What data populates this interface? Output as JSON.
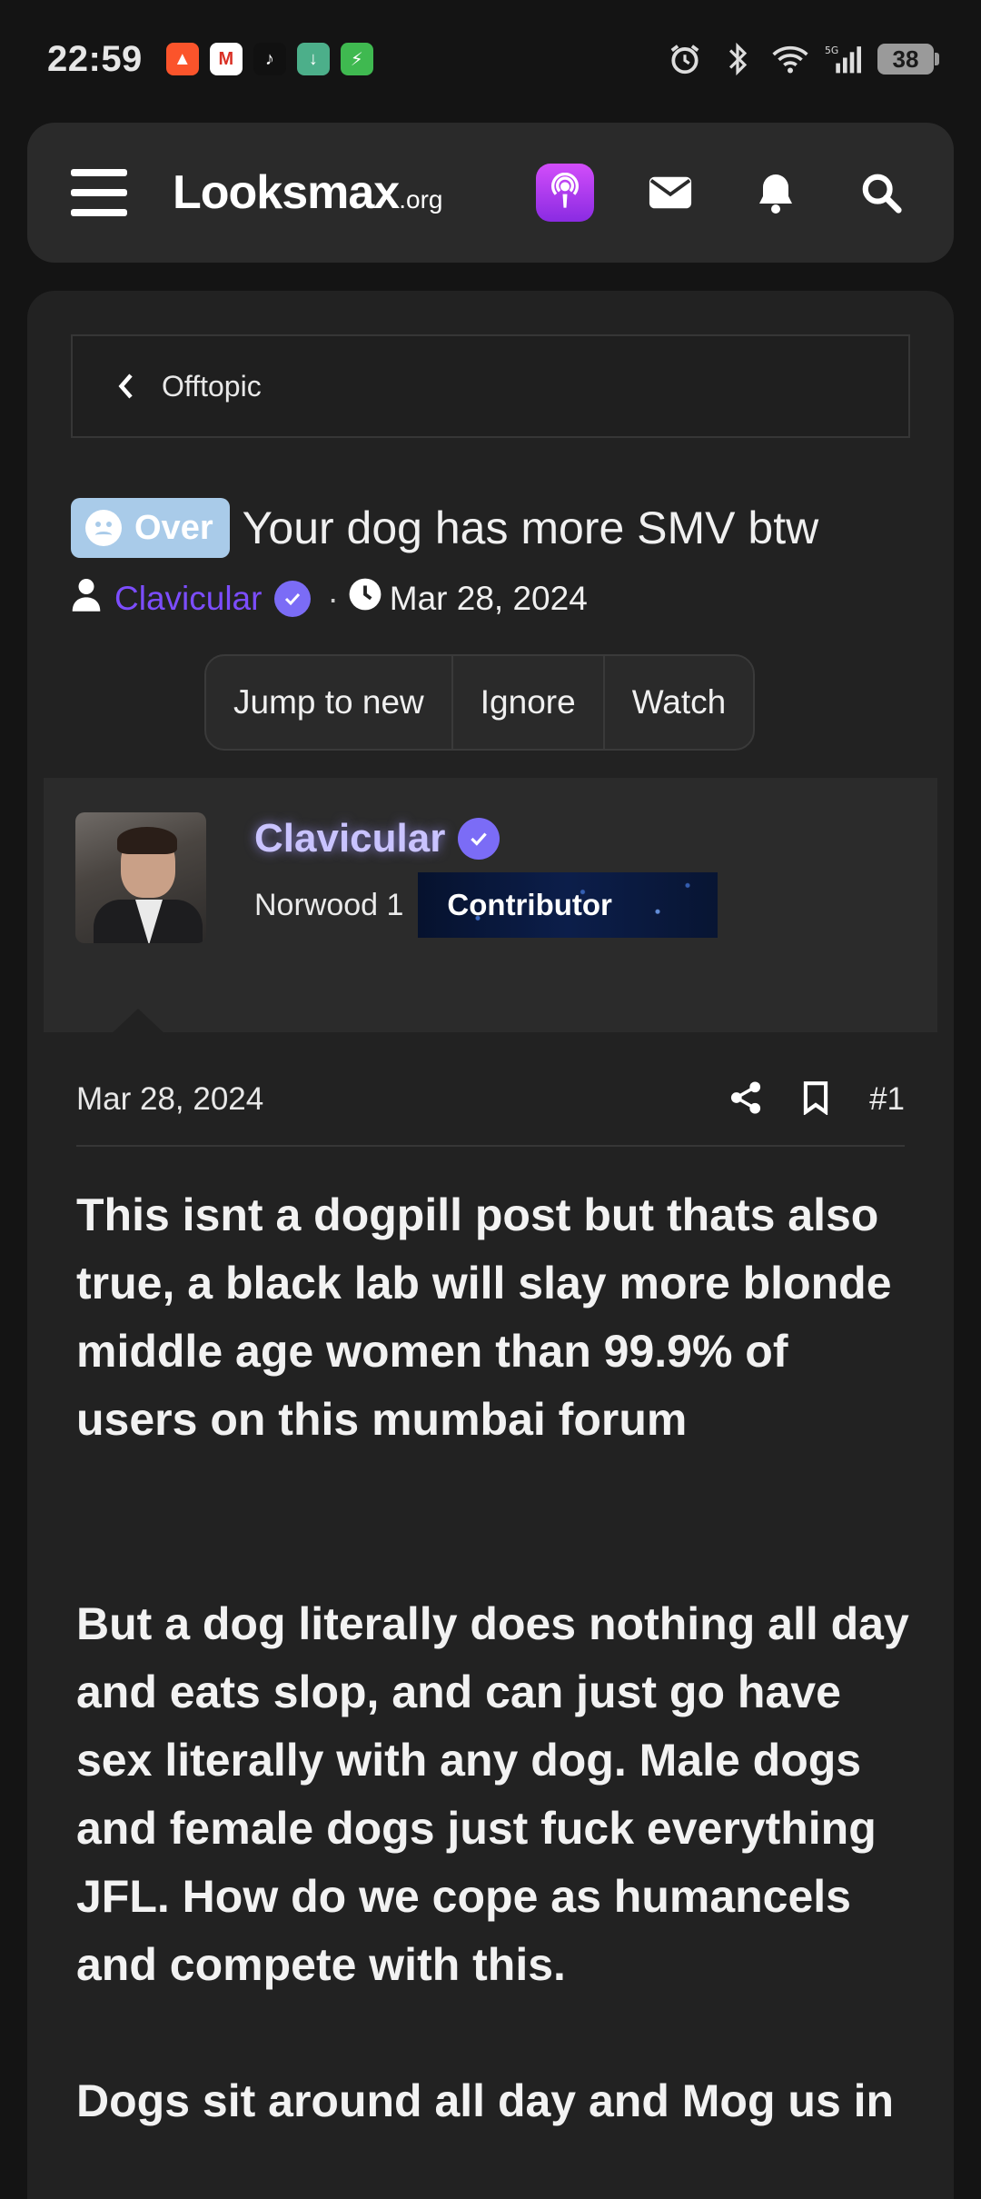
{
  "status_bar": {
    "time": "22:59",
    "battery": "38",
    "network": "5G",
    "apps": [
      {
        "name": "brave",
        "color": "#fb542b",
        "glyph": "▲"
      },
      {
        "name": "gmail",
        "color": "#ffffff",
        "glyph": "M"
      },
      {
        "name": "tiktok",
        "color": "#111111",
        "glyph": "♪"
      },
      {
        "name": "downloader",
        "color": "#4caf8a",
        "glyph": "↓"
      },
      {
        "name": "shield",
        "color": "#3fb950",
        "glyph": "⚡"
      }
    ]
  },
  "header": {
    "logo": "Looksmax",
    "logo_suffix": ".org",
    "icons": [
      "hamburger-menu-icon",
      "podcast-icon",
      "envelope-icon",
      "bell-icon",
      "search-icon"
    ]
  },
  "breadcrumb": {
    "label": "Offtopic"
  },
  "thread": {
    "prefix": "Over",
    "title": "Your dog has more SMV btw",
    "author": "Clavicular",
    "date": "Mar 28, 2024",
    "separator": "·"
  },
  "thread_buttons": {
    "jump": "Jump to new",
    "ignore": "Ignore",
    "watch": "Watch"
  },
  "post": {
    "author_name": "Clavicular",
    "author_title": "Norwood 1",
    "banner": "Contributor",
    "date": "Mar 28, 2024",
    "number": "#1",
    "paragraphs": [
      "This isnt a dogpill post but thats also true, a black lab will slay more blonde middle age women than 99.9% of users on this mumbai forum",
      "But a dog literally does nothing all day and eats slop, and can just go have sex literally with any dog. Male dogs and female dogs just fuck everything JFL. How do we cope as humancels and compete with this.",
      "Dogs sit around all day and Mog us in"
    ]
  },
  "colors": {
    "background": "#141414",
    "card": "#222222",
    "accent_username": "#7c4dff",
    "prefix_bg": "#a9cbe9",
    "verified": "#7b6cf6"
  }
}
